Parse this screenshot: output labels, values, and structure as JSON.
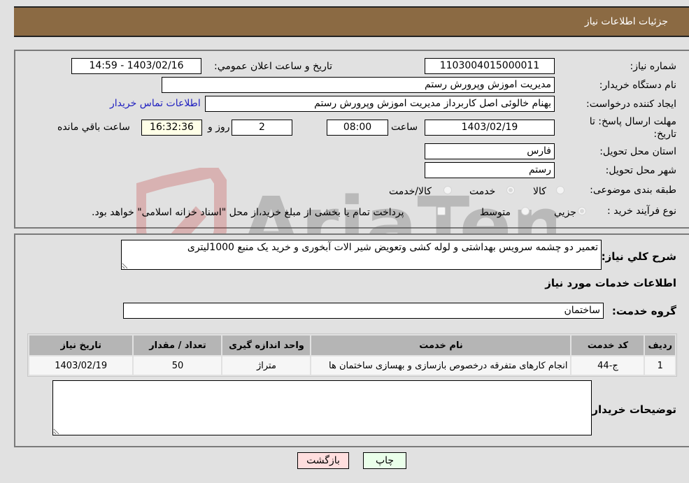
{
  "header": {
    "title": "جزئیات اطلاعات نیاز"
  },
  "form": {
    "need_number": {
      "label": "شماره نیاز:",
      "value": "1103004015000011"
    },
    "announce_datetime": {
      "label": "تاريخ و ساعت اعلان عمومي:",
      "value": "1403/02/16 - 14:59"
    },
    "buyer_org": {
      "label": "نام دستگاه خريدار:",
      "value": "مديريت اموزش وپرورش رستم"
    },
    "requester": {
      "label": "ايجاد کننده درخواست:",
      "value": "بهنام  خالوئی اصل کاربرداز مديريت اموزش وپرورش رستم"
    },
    "contact_link": "اطلاعات تماس خريدار",
    "deadline": {
      "label_line1": "مهلت ارسال پاسخ: تا",
      "label_line2": "تاریخ:",
      "date": "1403/02/19",
      "time_label": "ساعت",
      "time": "08:00",
      "days": "2",
      "days_label": "روز و",
      "remaining": "16:32:36",
      "remaining_label": "ساعت باقي مانده"
    },
    "province": {
      "label": "استان محل تحويل:",
      "value": "فارس"
    },
    "city": {
      "label": "شهر محل تحويل:",
      "value": "رستم"
    },
    "category": {
      "label": "طبقه بندی موضوعی:",
      "options": [
        "کالا",
        "خدمت",
        "کالا/خدمت"
      ],
      "selected": "خدمت"
    },
    "process": {
      "label": "نوع فرآيند خريد :",
      "options": [
        "جزيي",
        "متوسط"
      ],
      "selected": "جزيي",
      "treasury_note": "پرداخت تمام يا بخشی از مبلغ خريد،از محل \"اسناد خزانه اسلامی\" خواهد بود."
    }
  },
  "description": {
    "label": "شرح کلي نياز:",
    "value": "تعمير دو چشمه سرويس بهداشتی و لوله کشی وتعويض شير الات آبخوری و خريد يک منبع 1000ليتری"
  },
  "services": {
    "section_title": "اطلاعات خدمات مورد نياز",
    "group_label": "گروه خدمت:",
    "group_value": "ساختمان",
    "table": {
      "headers": [
        "رديف",
        "کد خدمت",
        "نام خدمت",
        "واحد اندازه گيری",
        "تعداد / مقدار",
        "تاريخ نياز"
      ],
      "rows": [
        [
          "1",
          "ج-44",
          "انجام کارهای متفرقه درخصوص بازسازی و بهسازی ساختمان ها",
          "متراژ",
          "50",
          "1403/02/19"
        ]
      ]
    }
  },
  "buyer_notes": {
    "label": "توضيحات خريدار:",
    "value": ""
  },
  "buttons": {
    "print": "چاپ",
    "back": "بازگشت"
  },
  "colors": {
    "header_bg": "#8b6a43",
    "print_bg": "#eaffea",
    "back_bg": "#ffdede"
  }
}
